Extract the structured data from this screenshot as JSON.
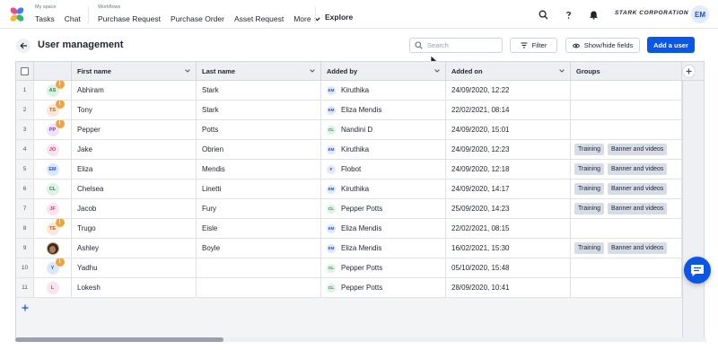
{
  "nav": {
    "my_space_label": "My space",
    "tasks": "Tasks",
    "chat": "Chat",
    "workflows_label": "Workflows",
    "purchase_request": "Purchase Request",
    "purchase_order": "Purchase Order",
    "asset_request": "Asset Request",
    "more": "More",
    "explore": "Explore",
    "company": "STARK CORPORATION",
    "user_initials": "EM"
  },
  "toolbar": {
    "title": "User management",
    "search_placeholder": "Search",
    "filter_label": "Filter",
    "show_hide_label": "Show/hide fields",
    "add_user_label": "Add a user"
  },
  "table": {
    "columns": {
      "first_name": "First name",
      "last_name": "Last name",
      "added_by": "Added by",
      "added_on": "Added on",
      "groups": "Groups"
    },
    "rows": [
      {
        "num": "1",
        "initials": "AS",
        "warn": true,
        "first": "Abhiram",
        "last": "Stark",
        "by_initials": "EM",
        "by_color": "#dbe7fd",
        "by_text": "#2456c6",
        "by": "Kiruthika",
        "on": "24/09/2020, 12:22",
        "groups": []
      },
      {
        "num": "2",
        "initials": "TS",
        "warn": true,
        "first": "Tony",
        "last": "Stark",
        "by_initials": "EM",
        "by_color": "#dbe7fd",
        "by_text": "#2456c6",
        "by": "Eliza Mendis",
        "on": "22/02/2021, 08:14",
        "groups": []
      },
      {
        "num": "3",
        "initials": "PP",
        "warn": true,
        "first": "Pepper",
        "last": "Potts",
        "by_initials": "CL",
        "by_color": "#dcf3e3",
        "by_text": "#1f8a4c",
        "by": "Nandini D",
        "on": "24/09/2020, 15:01",
        "groups": []
      },
      {
        "num": "4",
        "initials": "JO",
        "warn": false,
        "first": "Jake",
        "last": "Obrien",
        "by_initials": "EM",
        "by_color": "#dbe7fd",
        "by_text": "#2456c6",
        "by": "Kiruthika",
        "on": "24/09/2020, 12:23",
        "groups": [
          "Training",
          "Banner and videos"
        ]
      },
      {
        "num": "5",
        "initials": "EM",
        "warn": false,
        "first": "Eliza",
        "last": "Mendis",
        "by_initials": "F",
        "by_color": "#e3e6fb",
        "by_text": "#3b47b8",
        "by": "Flobot",
        "on": "24/09/2020, 12:18",
        "groups": [
          "Training",
          "Banner and videos"
        ]
      },
      {
        "num": "6",
        "initials": "CL",
        "warn": false,
        "first": "Chelsea",
        "last": "Linetti",
        "by_initials": "EM",
        "by_color": "#dbe7fd",
        "by_text": "#2456c6",
        "by": "Kiruthika",
        "on": "24/09/2020, 14:17",
        "groups": [
          "Training",
          "Banner and videos"
        ]
      },
      {
        "num": "7",
        "initials": "JF",
        "warn": false,
        "first": "Jacob",
        "last": "Fury",
        "by_initials": "CL",
        "by_color": "#dcf3e3",
        "by_text": "#1f8a4c",
        "by": "Pepper Potts",
        "on": "25/09/2020, 14:23",
        "groups": [
          "Training",
          "Banner and videos"
        ]
      },
      {
        "num": "8",
        "initials": "TE",
        "warn": true,
        "first": "Trugo",
        "last": "Eisle",
        "by_initials": "EM",
        "by_color": "#dbe7fd",
        "by_text": "#2456c6",
        "by": "Eliza Mendis",
        "on": "22/02/2021, 08:15",
        "groups": []
      },
      {
        "num": "9",
        "initials": "AB",
        "warn": false,
        "photo": true,
        "first": "Ashley",
        "last": "Boyle",
        "by_initials": "EM",
        "by_color": "#dbe7fd",
        "by_text": "#2456c6",
        "by": "Eliza Mendis",
        "on": "16/02/2021, 15:30",
        "groups": [
          "Training",
          "Banner and videos"
        ]
      },
      {
        "num": "10",
        "initials": "Y",
        "warn": true,
        "first": "Yadhu",
        "last": "",
        "by_initials": "CL",
        "by_color": "#dcf3e3",
        "by_text": "#1f8a4c",
        "by": "Pepper Potts",
        "on": "05/10/2020, 15:48",
        "groups": []
      },
      {
        "num": "11",
        "initials": "L",
        "warn": false,
        "first": "Lokesh",
        "last": "",
        "by_initials": "CL",
        "by_color": "#dcf3e3",
        "by_text": "#1f8a4c",
        "by": "Pepper Potts",
        "on": "28/09/2020, 10:41",
        "groups": []
      }
    ]
  },
  "avatar_colors": {
    "AS": [
      "#dcf3e3",
      "#1f8a4c"
    ],
    "TS": [
      "#fde8d7",
      "#c2571a"
    ],
    "PP": [
      "#efe3fb",
      "#7b3fc2"
    ],
    "JO": [
      "#fde3ef",
      "#c2387a"
    ],
    "EM": [
      "#dbe7fd",
      "#2456c6"
    ],
    "CL": [
      "#dcf3e3",
      "#1f8a4c"
    ],
    "JF": [
      "#fde3ef",
      "#c2387a"
    ],
    "TE": [
      "#fde8d7",
      "#c2571a"
    ],
    "AB": [
      "#e7d6c7",
      "#5a3a22"
    ],
    "Y": [
      "#dbe7fd",
      "#2456c6"
    ],
    "L": [
      "#fde3ef",
      "#c2387a"
    ]
  },
  "colors": {
    "primary": "#0b57e5",
    "warning": "#f2a43a",
    "chip_bg": "#d7dde6"
  }
}
